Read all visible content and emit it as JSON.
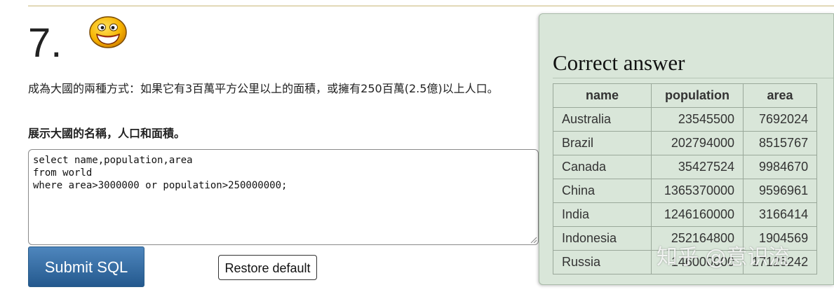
{
  "question": {
    "number": "7.",
    "description": "成為大國的兩種方式：如果它有3百萬平方公里以上的面積，或擁有250百萬(2.5億)以上人口。",
    "task": "展示大國的名稱，人口和面積。"
  },
  "editor": {
    "sql": "select name,population,area\nfrom world\nwhere area>3000000 or population>250000000;"
  },
  "buttons": {
    "submit_label": "Submit SQL",
    "restore_label": "Restore default"
  },
  "answer": {
    "title": "Correct answer",
    "columns": [
      "name",
      "population",
      "area"
    ],
    "rows": [
      [
        "Australia",
        "23545500",
        "7692024"
      ],
      [
        "Brazil",
        "202794000",
        "8515767"
      ],
      [
        "Canada",
        "35427524",
        "9984670"
      ],
      [
        "China",
        "1365370000",
        "9596961"
      ],
      [
        "India",
        "1246160000",
        "3166414"
      ],
      [
        "Indonesia",
        "252164800",
        "1904569"
      ],
      [
        "Russia",
        "146000000",
        "17125242"
      ]
    ]
  },
  "watermark": "知乎 @意识流",
  "colors": {
    "panel_bg": "#d9e6d9",
    "submit_top": "#4e86bd",
    "submit_bottom": "#24598e",
    "rule": "#c8b777"
  }
}
